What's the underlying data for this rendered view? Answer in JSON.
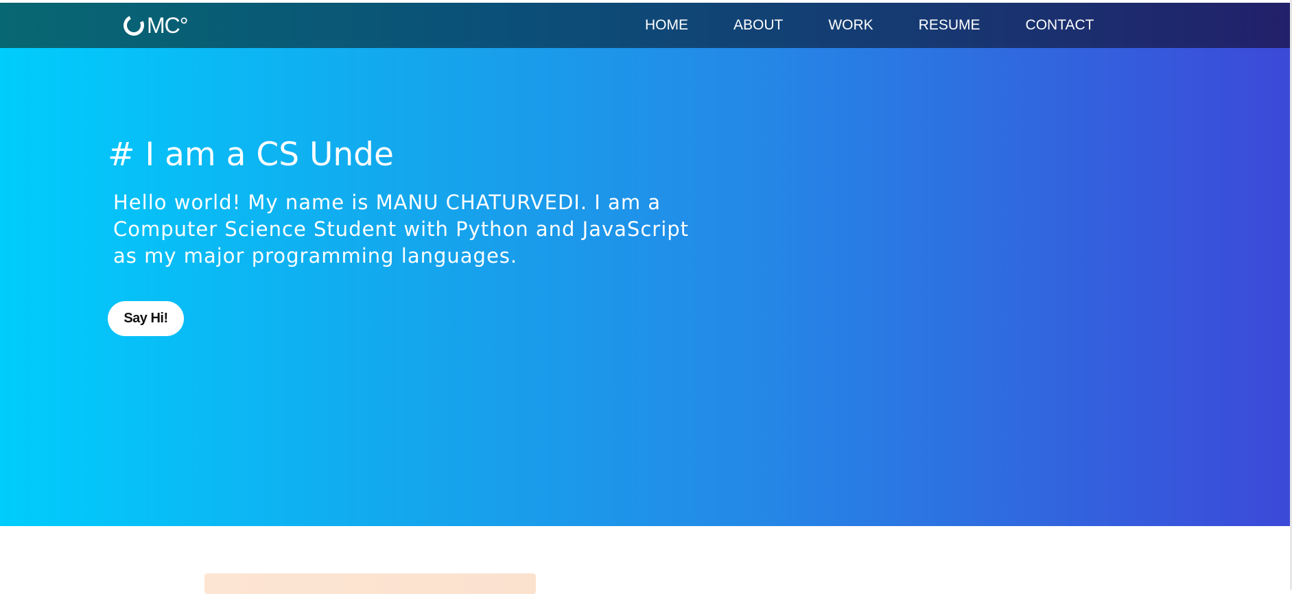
{
  "navbar": {
    "logo_text": "MC°",
    "links": [
      {
        "label": "HOME"
      },
      {
        "label": "ABOUT"
      },
      {
        "label": "WORK"
      },
      {
        "label": "RESUME"
      },
      {
        "label": "CONTACT"
      }
    ]
  },
  "hero": {
    "heading": "# I am a CS Unde",
    "paragraph": "Hello world! My name is MANU CHATURVEDI. I am a Computer Science Student with Python and JavaScript as my major programming languages.",
    "cta_label": "Say Hi!"
  },
  "colors": {
    "navbar_gradient": [
      "#076772",
      "#22206a"
    ],
    "hero_gradient": [
      "#00cdfc",
      "#3c49d8"
    ],
    "card_peek": "#fde5d3"
  },
  "icons": {
    "logo": "ring-logo-icon"
  }
}
